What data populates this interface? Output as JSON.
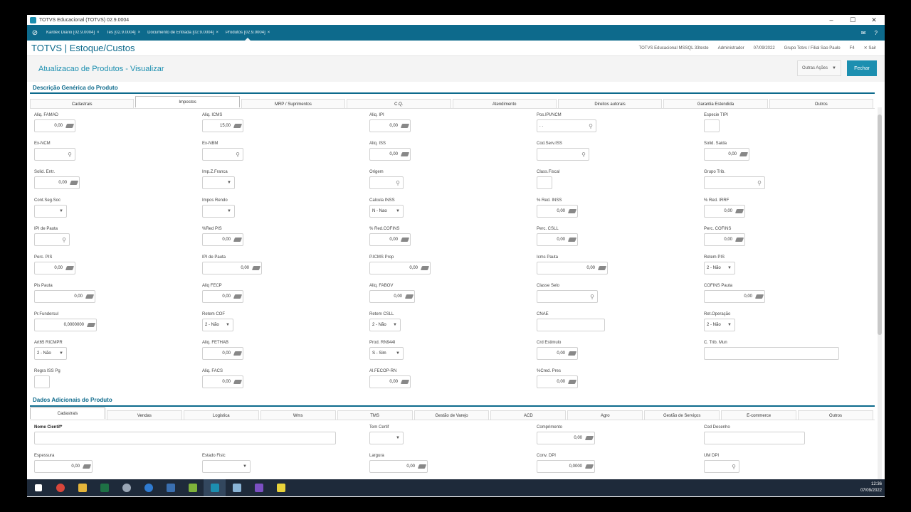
{
  "window": {
    "title": "TOTVS Educacional (TOTVS) 02.9.0004",
    "min": "–",
    "max": "☐",
    "close": "✕"
  },
  "tabs": [
    {
      "label": "Kardex Diário [02.9.0004]",
      "close": "×"
    },
    {
      "label": "Tes [02.9.0004]",
      "close": "×"
    },
    {
      "label": "Documento de Entrada [02.9.0004]",
      "close": "×"
    },
    {
      "label": "Produtos [02.9.0004]",
      "close": "×"
    }
  ],
  "header": {
    "title": "TOTVS | Estoque/Custos",
    "env": "TOTVS Educacional MSSQL 33teste",
    "user": "Administrador",
    "date": "07/09/2022",
    "branch": "Grupo Totvs / Filial Sao Paulo",
    "f4": "F4",
    "sair": "Sair"
  },
  "actionbar": {
    "title": "Atualizacao de Produtos - Visualizar",
    "outras": "Outras Ações",
    "fechar": "Fechar"
  },
  "section1": {
    "title": "Descrição Genérica do Produto",
    "tabs": [
      "Cadastrais",
      "Impostos",
      "MRP / Suprimentos",
      "C.Q.",
      "Atendimento",
      "Direitos autorais",
      "Garantia Estendida",
      "Outros"
    ]
  },
  "section2": {
    "title": "Dados Adicionais do Produto",
    "tabs": [
      "Cadastrais",
      "Vendas",
      "Logistica",
      "Wms",
      "TMS",
      "Gestão de Varejo",
      "ACD",
      "Agro",
      "Gestão de Serviços",
      "E-commerce",
      "Outros"
    ]
  },
  "fields": [
    {
      "label": "Aliq. FAMAD",
      "value": "0,00",
      "suffix": "calc"
    },
    {
      "label": "Aliq. ICMS",
      "value": "15,00",
      "suffix": "calc"
    },
    {
      "label": "Aliq. IPI",
      "value": "0,00",
      "suffix": "calc"
    },
    {
      "label": "Pos.IPI/NCM",
      "value": ". .",
      "suffix": "search"
    },
    {
      "label": "Especie TIPI",
      "value": "",
      "suffix": ""
    },
    {
      "label": "Ex-NCM",
      "value": "",
      "suffix": "search"
    },
    {
      "label": "Ex-NBM",
      "value": "",
      "suffix": "search"
    },
    {
      "label": "Aliq. ISS",
      "value": "0,00",
      "suffix": "calc"
    },
    {
      "label": "Cod.Serv.ISS",
      "value": "",
      "suffix": "search"
    },
    {
      "label": "Solid. Saida",
      "value": "0,00",
      "suffix": "calc"
    },
    {
      "label": "Solid. Entr.",
      "value": "0,00",
      "suffix": "calc"
    },
    {
      "label": "Imp.Z.Franca",
      "value": "",
      "suffix": "select"
    },
    {
      "label": "Origem",
      "value": "",
      "suffix": "search"
    },
    {
      "label": "Class.Fiscal",
      "value": "",
      "suffix": ""
    },
    {
      "label": "Grupo Trib.",
      "value": "",
      "suffix": "search"
    },
    {
      "label": "Cont.Seg.Soc",
      "value": "",
      "suffix": "select"
    },
    {
      "label": "Impos Rendo",
      "value": "",
      "suffix": "select"
    },
    {
      "label": "Calcula INSS",
      "value": "N - Nao",
      "suffix": "select"
    },
    {
      "label": "% Red. INSS",
      "value": "0,00",
      "suffix": "calc"
    },
    {
      "label": "% Red. IRRF",
      "value": "0,00",
      "suffix": "calc"
    },
    {
      "label": "IPI de Pauta",
      "value": "",
      "suffix": "search"
    },
    {
      "label": "%Red PIS",
      "value": "0,00",
      "suffix": "calc"
    },
    {
      "label": "% Red.COFINS",
      "value": "0,00",
      "suffix": "calc"
    },
    {
      "label": "Perc. CSLL",
      "value": "0,00",
      "suffix": "calc"
    },
    {
      "label": "Perc. COFINS",
      "value": "0,00",
      "suffix": "calc"
    },
    {
      "label": "Perc. PIS",
      "value": "0,00",
      "suffix": "calc"
    },
    {
      "label": "IPI de Pauta",
      "value": "0,00",
      "suffix": "calc"
    },
    {
      "label": "P.ICMS Prop",
      "value": "0,00",
      "suffix": "calc"
    },
    {
      "label": "Icms Pauta",
      "value": "0,00",
      "suffix": "calc"
    },
    {
      "label": "Retem PIS",
      "value": "2 - Não",
      "suffix": "select"
    },
    {
      "label": "Pis Pauta",
      "value": "0,00",
      "suffix": "calc"
    },
    {
      "label": "Aliq FECP",
      "value": "0,00",
      "suffix": "calc"
    },
    {
      "label": "Aliq. FABOV",
      "value": "0,00",
      "suffix": "calc"
    },
    {
      "label": "Classe Selo",
      "value": "",
      "suffix": "search"
    },
    {
      "label": "COFINS Pauta",
      "value": "0,00",
      "suffix": "calc"
    },
    {
      "label": "Pr.Fundersul",
      "value": "0,0000000",
      "suffix": "calc"
    },
    {
      "label": "Retem COF",
      "value": "2 - Não",
      "suffix": "select"
    },
    {
      "label": "Retem CSLL",
      "value": "2 - Não",
      "suffix": "select"
    },
    {
      "label": "CNAE",
      "value": "",
      "suffix": ""
    },
    {
      "label": "Ret.Operação",
      "value": "2 - Não",
      "suffix": "select"
    },
    {
      "label": "Art65 RICMPR",
      "value": "2 - Não",
      "suffix": "select"
    },
    {
      "label": "Aliq. FETHAB",
      "value": "0,00",
      "suffix": "calc"
    },
    {
      "label": "Prod. RN944I",
      "value": "S - Sim",
      "suffix": "select"
    },
    {
      "label": "Crd Estimulo",
      "value": "0,00",
      "suffix": "calc"
    },
    {
      "label": "C. Trib. Mun",
      "value": "",
      "suffix": ""
    },
    {
      "label": "Regra ISS Pg",
      "value": "",
      "suffix": ""
    },
    {
      "label": "Aliq. FACS",
      "value": "0,00",
      "suffix": "calc"
    },
    {
      "label": "Al.FECOP-RN",
      "value": "0,00",
      "suffix": "calc"
    },
    {
      "label": "%Cred. Pres",
      "value": "0,00",
      "suffix": "calc"
    }
  ],
  "fields2": [
    {
      "label": "Nome Científ*",
      "value": "",
      "suffix": "",
      "bold": true
    },
    {
      "label": "Tem Certif",
      "value": "",
      "suffix": "select"
    },
    {
      "label": "Comprimento",
      "value": "0,00",
      "suffix": "calc"
    },
    {
      "label": "Cod Desenho",
      "value": "",
      "suffix": ""
    },
    {
      "label": "Espessura",
      "value": "0,00",
      "suffix": "calc"
    },
    {
      "label": "Estado Fisic",
      "value": "",
      "suffix": "select"
    },
    {
      "label": "Largura",
      "value": "0,00",
      "suffix": "calc"
    },
    {
      "label": "Conv. DPI",
      "value": "0,0000",
      "suffix": "calc"
    },
    {
      "label": "UM DPI",
      "value": "",
      "suffix": "search"
    }
  ],
  "taskbar": {
    "time": "12:36",
    "date": "07/09/2022"
  },
  "colors": {
    "brand": "#0d6a8c",
    "accent": "#1c8fb0"
  }
}
